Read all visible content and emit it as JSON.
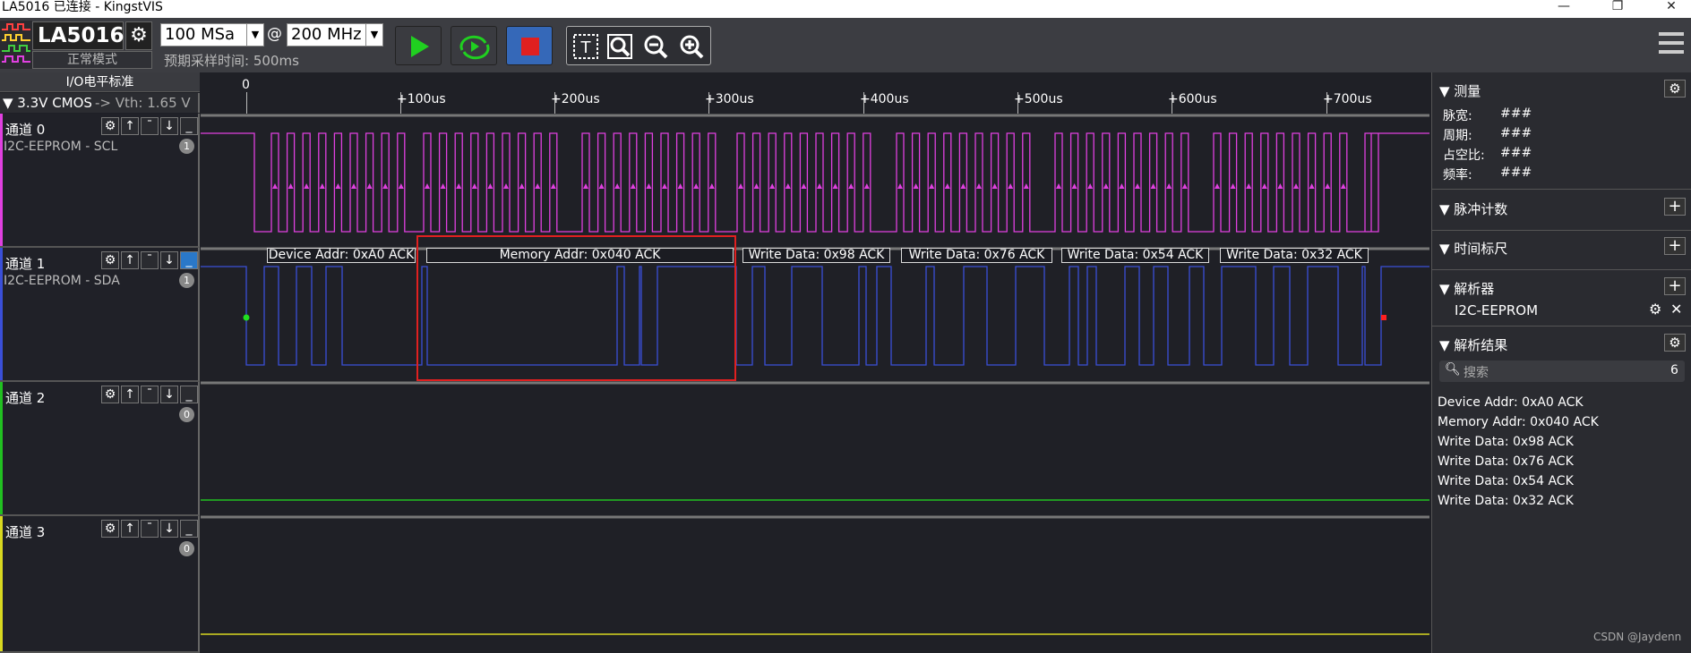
{
  "window": {
    "title": "LA5016 已连接 - KingstVIS"
  },
  "toolbar": {
    "device_name": "LA5016",
    "device_mode": "正常模式",
    "sample_depth": "100 MSa",
    "at": "@",
    "sample_rate": "200 MHz",
    "sample_time": "预期采样时间: 500ms"
  },
  "left": {
    "io_standard_label": "I/O电平标准",
    "io_standard_value": "▼ 3.3V CMOS",
    "vth": "-> Vth: 1.65 V"
  },
  "channels": [
    {
      "name": "通道 0",
      "sub": "I2C-EEPROM - SCL",
      "badge": "1",
      "color": "#e040e0"
    },
    {
      "name": "通道 1",
      "sub": "I2C-EEPROM - SDA",
      "badge": "1",
      "color": "#3a4fd8"
    },
    {
      "name": "通道 2",
      "sub": "",
      "badge": "0",
      "color": "#21c021"
    },
    {
      "name": "通道 3",
      "sub": "",
      "badge": "0",
      "color": "#d8d820"
    }
  ],
  "ruler": {
    "zero": "0",
    "ticks": [
      "+100us",
      "+200us",
      "+300us",
      "+400us",
      "+500us",
      "+600us",
      "+700us"
    ]
  },
  "decode_labels": [
    "Device Addr: 0xA0 ACK",
    "Memory Addr: 0x040 ACK",
    "Write Data: 0x98 ACK",
    "Write Data: 0x76 ACK",
    "Write Data: 0x54 ACK",
    "Write Data: 0x32 ACK"
  ],
  "right": {
    "measure_title": "▼ 测量",
    "measure_rows": [
      {
        "label": "脉宽:",
        "value": "###"
      },
      {
        "label": "周期:",
        "value": "###"
      },
      {
        "label": "占空比:",
        "value": "###"
      },
      {
        "label": "频率:",
        "value": "###"
      }
    ],
    "pulse_title": "▼ 脉冲计数",
    "ruler_title": "▼ 时间标尺",
    "analyzer_title": "▼ 解析器",
    "analyzer_item": "I2C-EEPROM",
    "results_title": "▼ 解析结果",
    "search_placeholder": "搜索",
    "result_count": "6",
    "results": [
      "Device Addr: 0xA0 ACK",
      "Memory Addr: 0x040 ACK",
      "Write Data: 0x98 ACK",
      "Write Data: 0x76 ACK",
      "Write Data: 0x54 ACK",
      "Write Data: 0x32 ACK"
    ]
  },
  "watermark": "CSDN @Jaydenn"
}
